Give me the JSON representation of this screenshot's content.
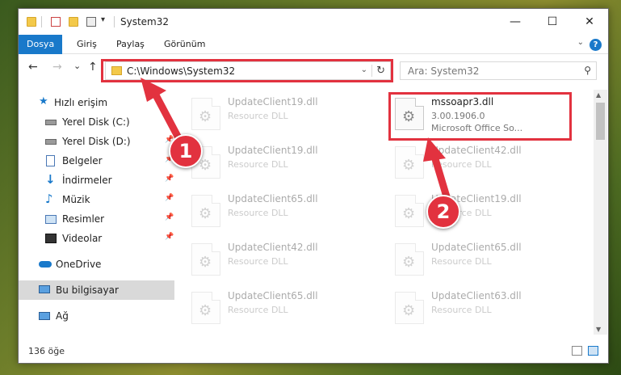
{
  "window": {
    "title": "System32",
    "controls": {
      "minimize": "—",
      "maximize": "☐",
      "close": "✕"
    }
  },
  "ribbon": {
    "tabs": [
      {
        "label": "Dosya",
        "active": true
      },
      {
        "label": "Giriş"
      },
      {
        "label": "Paylaş"
      },
      {
        "label": "Görünüm"
      }
    ],
    "help": "?"
  },
  "nav": {
    "back": "←",
    "forward": "→",
    "recent": "⌄",
    "up": "↑",
    "address": "C:\\Windows\\System32",
    "search_placeholder": "Ara: System32"
  },
  "sidebar": {
    "items": [
      {
        "label": "Hızlı erişim",
        "icon": "star-icon"
      },
      {
        "label": "Yerel Disk (C:)",
        "icon": "drive-icon",
        "pinned": true
      },
      {
        "label": "Yerel Disk (D:)",
        "icon": "drive-icon",
        "pinned": true
      },
      {
        "label": "Belgeler",
        "icon": "documents-icon",
        "pinned": true
      },
      {
        "label": "İndirmeler",
        "icon": "download-icon",
        "pinned": true
      },
      {
        "label": "Müzik",
        "icon": "music-icon",
        "pinned": true
      },
      {
        "label": "Resimler",
        "icon": "pictures-icon",
        "pinned": true
      },
      {
        "label": "Videolar",
        "icon": "video-icon",
        "pinned": true
      },
      {
        "label": "OneDrive",
        "icon": "cloud-icon"
      },
      {
        "label": "Bu bilgisayar",
        "icon": "computer-icon",
        "selected": true
      },
      {
        "label": "Ağ",
        "icon": "network-icon"
      }
    ]
  },
  "files": {
    "left": [
      {
        "name": "UpdateClient19.dll",
        "type": "Resource DLL"
      },
      {
        "name": "UpdateClient19.dll",
        "type": "Resource DLL"
      },
      {
        "name": "UpdateClient65.dll",
        "type": "Resource DLL"
      },
      {
        "name": "UpdateClient42.dll",
        "type": "Resource DLL"
      },
      {
        "name": "UpdateClient65.dll",
        "type": "Resource DLL"
      }
    ],
    "highlighted": {
      "name": "mssoapr3.dll",
      "version": "3.00.1906.0",
      "description": "Microsoft Office So..."
    },
    "right": [
      {
        "name": "UpdateClient42.dll",
        "type": "Resource DLL"
      },
      {
        "name": "UpdateClient19.dll",
        "type": "Resource DLL"
      },
      {
        "name": "UpdateClient65.dll",
        "type": "Resource DLL"
      },
      {
        "name": "UpdateClient63.dll",
        "type": "Resource DLL"
      }
    ]
  },
  "status": {
    "count": "136 öğe"
  },
  "annotations": {
    "step1": "1",
    "step2": "2"
  },
  "colors": {
    "accent": "#1979ca",
    "annotation": "#e2323f"
  }
}
